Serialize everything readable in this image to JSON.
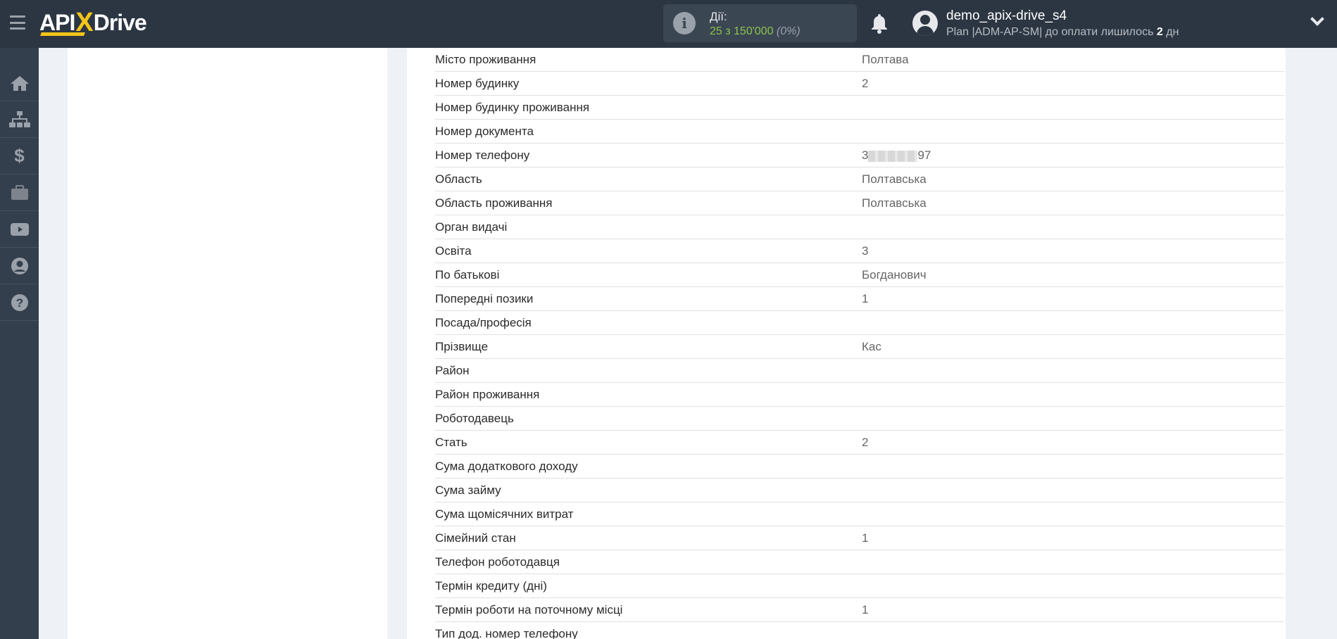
{
  "header": {
    "logo": "APIXDrive",
    "actions_label": "Дії:",
    "actions_count": "25 з 150'000",
    "actions_percent": "(0%)",
    "username": "demo_apix-drive_s4",
    "plan_text": "Plan |ADM-AP-SM| до оплати лишилось",
    "plan_days": "2",
    "plan_unit": "дн"
  },
  "sidebar": {
    "items": [
      "home-icon",
      "sitemap-icon",
      "dollar-icon",
      "briefcase-icon",
      "youtube-icon",
      "user-circle-icon",
      "question-icon"
    ]
  },
  "rows": [
    {
      "label": "Місто проживання",
      "value": "Полтава"
    },
    {
      "label": "Номер будинку",
      "value": "2"
    },
    {
      "label": "Номер будинку проживання",
      "value": ""
    },
    {
      "label": "Номер документа",
      "value": ""
    },
    {
      "label": "Номер телефону",
      "value": "3",
      "value_end": "97",
      "masked": true
    },
    {
      "label": "Область",
      "value": "Полтавська"
    },
    {
      "label": "Область проживання",
      "value": "Полтавська"
    },
    {
      "label": "Орган видачі",
      "value": ""
    },
    {
      "label": "Освіта",
      "value": "3"
    },
    {
      "label": "По батькові",
      "value": "Богданович"
    },
    {
      "label": "Попередні позики",
      "value": "1"
    },
    {
      "label": "Посада/професія",
      "value": ""
    },
    {
      "label": "Прізвище",
      "value": "Кас"
    },
    {
      "label": "Район",
      "value": ""
    },
    {
      "label": "Район проживання",
      "value": ""
    },
    {
      "label": "Роботодавець",
      "value": ""
    },
    {
      "label": "Стать",
      "value": "2"
    },
    {
      "label": "Сума додаткового доходу",
      "value": ""
    },
    {
      "label": "Сума займу",
      "value": ""
    },
    {
      "label": "Сума щомісячних витрат",
      "value": ""
    },
    {
      "label": "Сімейний стан",
      "value": "1"
    },
    {
      "label": "Телефон роботодавця",
      "value": ""
    },
    {
      "label": "Термін кредиту (дні)",
      "value": ""
    },
    {
      "label": "Термін роботи на поточному місці",
      "value": "1"
    },
    {
      "label": "Тип дод. номер телефону",
      "value": ""
    }
  ]
}
